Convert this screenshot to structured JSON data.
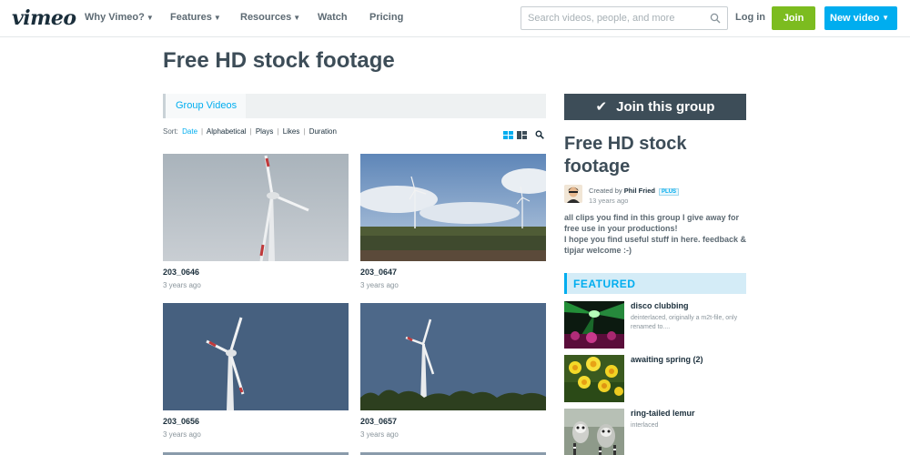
{
  "nav": {
    "logo": "vimeo",
    "items": [
      {
        "label": "Why Vimeo?",
        "caret": true
      },
      {
        "label": "Features",
        "caret": true
      },
      {
        "label": "Resources",
        "caret": true
      },
      {
        "label": "Watch",
        "caret": false
      },
      {
        "label": "Pricing",
        "caret": false
      }
    ],
    "search_placeholder": "Search videos, people, and more",
    "login_label": "Log in",
    "join_label": "Join",
    "new_video_label": "New video"
  },
  "page": {
    "title": "Free HD stock footage"
  },
  "tabs": {
    "active": "Group Videos"
  },
  "sort": {
    "label": "Sort:",
    "options": [
      "Date",
      "Alphabetical",
      "Plays",
      "Likes",
      "Duration"
    ],
    "active": "Date"
  },
  "videos": [
    {
      "title": "203_0646",
      "date": "3 years ago"
    },
    {
      "title": "203_0647",
      "date": "3 years ago"
    },
    {
      "title": "203_0656",
      "date": "3 years ago"
    },
    {
      "title": "203_0657",
      "date": "3 years ago"
    }
  ],
  "sidebar": {
    "join_group_label": "Join this group",
    "group_title": "Free HD stock footage",
    "created_by_prefix": "Created by",
    "author": "Phil Fried",
    "author_badge": "PLUS",
    "created_ago": "13 years ago",
    "description": "all clips you find in this group I give away for free use in your productions!\nI hope you find useful stuff in here. feedback & tipjar welcome :-)",
    "featured_label": "FEATURED",
    "featured": [
      {
        "title": "disco clubbing",
        "desc": "deinterlaced, originally a m2t-file, only renamed to...."
      },
      {
        "title": "awaiting spring (2)",
        "desc": ""
      },
      {
        "title": "ring-tailed lemur",
        "desc": "interlaced"
      }
    ]
  },
  "colors": {
    "brand_dark": "#1a2e3b",
    "accent_blue": "#00adef",
    "join_green": "#7cbc1f",
    "slate": "#3d4d58"
  }
}
